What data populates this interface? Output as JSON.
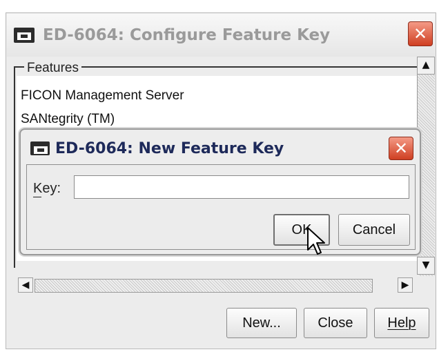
{
  "main_window": {
    "title": "ED-6064: Configure Feature Key",
    "features_label": "Features",
    "features": [
      "FICON Management Server",
      "SANtegrity (TM)"
    ],
    "buttons": {
      "new": "New...",
      "close": "Close",
      "help": "Help"
    },
    "close_icon": "close-x-icon"
  },
  "dialog": {
    "title": "ED-6064: New Feature Key",
    "key_label": "Key:",
    "key_value": "",
    "ok": "OK",
    "cancel": "Cancel",
    "close_icon": "close-x-icon"
  },
  "colors": {
    "close_button": "#cf3f22",
    "dialog_title": "#1e2a5a",
    "inactive_title": "#9a9a9a"
  }
}
